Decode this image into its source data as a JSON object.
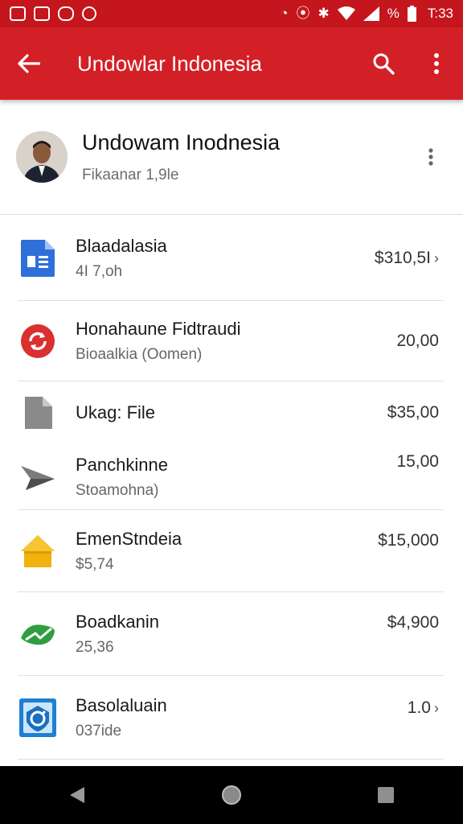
{
  "status_bar": {
    "time": "T:33",
    "battery_text": "%",
    "icons": [
      "image-notification-icon",
      "mail-notification-icon",
      "chat-notification-icon",
      "vpn-notification-icon",
      "alarm-icon",
      "location-icon",
      "vibrate-icon",
      "wifi-icon",
      "signal-icon",
      "battery-icon"
    ]
  },
  "app_bar": {
    "title": "Undowlar Indonesia",
    "icons": [
      "back-arrow-icon",
      "search-icon",
      "more-vert-icon"
    ]
  },
  "profile": {
    "name": "Undowam Inodnesia",
    "subtitle": "Fikaanar 1,9le"
  },
  "items": [
    {
      "title": "Blaadalasia",
      "subtitle": "4I 7,oh",
      "amount": "$310,5I",
      "chevron": true,
      "icon": "document-icon"
    },
    {
      "title": "Honahaune Fidtraudi",
      "subtitle": "Bioaalkia (Oomen)",
      "amount": "20,00",
      "chevron": false,
      "icon": "sync-circle-icon"
    },
    {
      "title": "Ukag: File",
      "subtitle": "",
      "amount": "$35,00",
      "chevron": false,
      "icon": "file-icon"
    },
    {
      "title": "Panchkinne",
      "subtitle": "Stoamohna)",
      "amount": "15,00",
      "chevron": false,
      "icon": "send-icon"
    },
    {
      "title": "EmenStndeia",
      "subtitle": "$5,74",
      "amount": "$15,000",
      "chevron": false,
      "icon": "home-icon"
    },
    {
      "title": "Boadkanin",
      "subtitle": "25,36",
      "amount": "$4,900",
      "chevron": false,
      "icon": "leaf-icon"
    },
    {
      "title": "Basolaluain",
      "subtitle": "037ide",
      "amount": "1.0",
      "chevron": true,
      "icon": "badge-icon"
    }
  ],
  "colors": {
    "status_bar": "#c4161c",
    "app_bar": "#d32027",
    "nav_bar": "#000000"
  }
}
